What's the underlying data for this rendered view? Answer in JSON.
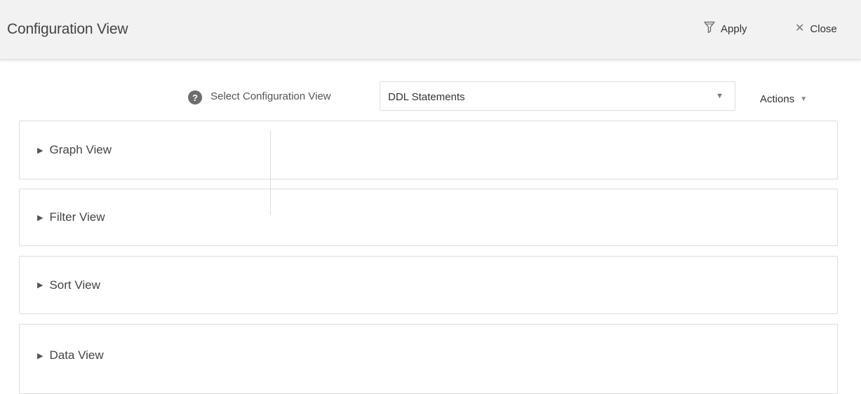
{
  "header": {
    "title": "Configuration View",
    "apply_label": "Apply",
    "apply_icon": "funnel-icon",
    "close_label": "Close",
    "close_icon": "close-icon"
  },
  "selector": {
    "help_icon": "question-circle-icon",
    "label": "Select Configuration View",
    "value": "DDL Statements",
    "actions_label": "Actions"
  },
  "panels": [
    {
      "label": "Graph View",
      "expanded": false
    },
    {
      "label": "Filter View",
      "expanded": false
    },
    {
      "label": "Sort View",
      "expanded": false
    },
    {
      "label": "Data View",
      "expanded": false
    }
  ]
}
